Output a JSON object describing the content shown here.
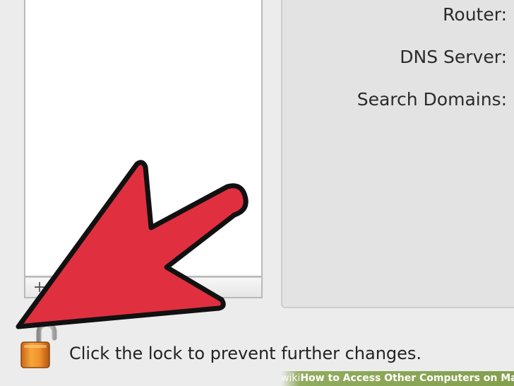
{
  "sidebar": {
    "add_label": "+"
  },
  "details": {
    "router_label": "Router:",
    "dns_label": "DNS Server:",
    "search_domains_label": "Search Domains:"
  },
  "lock": {
    "icon": "unlocked-padlock-icon",
    "message": "Click the lock to prevent further changes."
  },
  "annotation": {
    "arrow_color": "#e03040"
  },
  "watermark": {
    "brand": "wiki",
    "how": "How",
    "title": " to Access Other Computers on Mac"
  }
}
